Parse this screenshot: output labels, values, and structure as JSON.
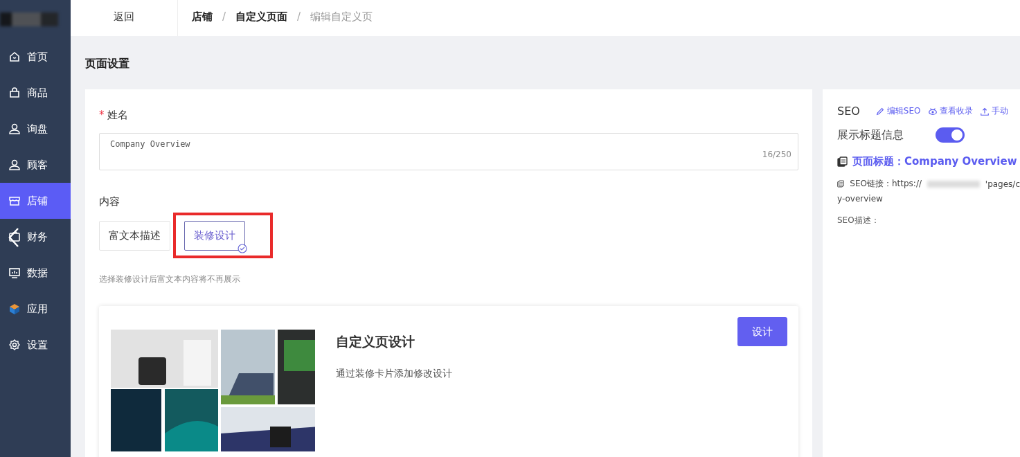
{
  "sidebar": {
    "items": [
      {
        "label": "首页",
        "selected": false
      },
      {
        "label": "商品",
        "selected": false
      },
      {
        "label": "询盘",
        "selected": false
      },
      {
        "label": "顾客",
        "selected": false
      },
      {
        "label": "店铺",
        "selected": true
      },
      {
        "label": "财务",
        "selected": false
      },
      {
        "label": "数据",
        "selected": false
      },
      {
        "label": "应用",
        "selected": false
      },
      {
        "label": "设置",
        "selected": false
      }
    ]
  },
  "topbar": {
    "back": "返回",
    "breadcrumb": [
      "店铺",
      "自定义页面",
      "编辑自定义页"
    ],
    "separators": [
      "/",
      "/"
    ]
  },
  "page_title": "页面设置",
  "form": {
    "required_mark": "*",
    "name_label": "姓名",
    "name_value": "Company Overview",
    "name_count": "16/250",
    "content_label": "内容",
    "content_options": [
      {
        "label": "富文本描述",
        "selected": false
      },
      {
        "label": "装修设计",
        "selected": true
      }
    ],
    "hint": "选择装修设计后富文本内容将不再展示",
    "design_card": {
      "title": "自定义页设计",
      "description": "通过装修卡片添加修改设计",
      "button": "设计"
    }
  },
  "seo": {
    "title": "SEO",
    "actions": [
      {
        "label": "编辑SEO"
      },
      {
        "label": "查看收录"
      },
      {
        "label": "手动"
      }
    ],
    "show_title_label": "展示标题信息",
    "show_title_on": true,
    "page_title": "页面标题：Company Overview",
    "link_prefix": "SEO链接：https://",
    "link_mid": "'pages/c",
    "link_end": "y-overview",
    "description_label": "SEO描述："
  }
}
